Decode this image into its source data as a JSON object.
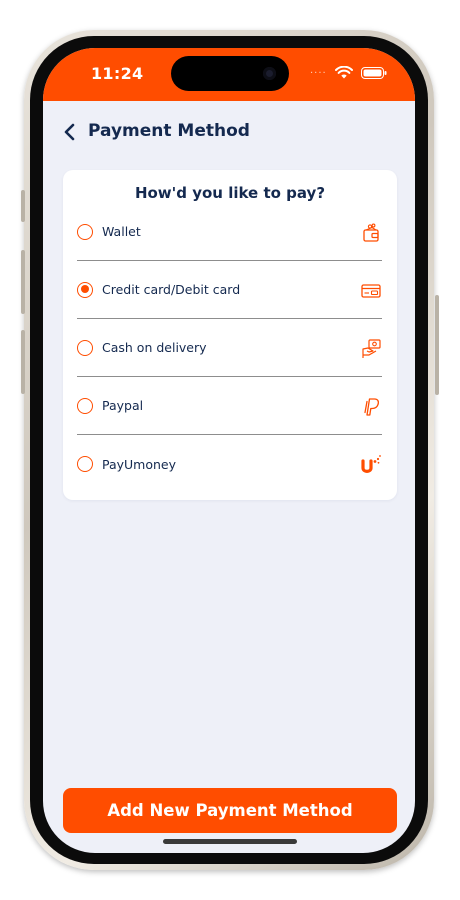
{
  "status_bar": {
    "time": "11:24",
    "signal_dots": "....",
    "background": "#ff4d00"
  },
  "header": {
    "title": "Payment Method",
    "back_icon": "chevron-left-icon"
  },
  "payment_card": {
    "title": "How'd you like to pay?",
    "options": [
      {
        "label": "Wallet",
        "icon": "wallet-icon",
        "selected": false
      },
      {
        "label": "Credit card/Debit card",
        "icon": "credit-card-icon",
        "selected": true
      },
      {
        "label": "Cash on delivery",
        "icon": "cash-icon",
        "selected": false
      },
      {
        "label": "Paypal",
        "icon": "paypal-icon",
        "selected": false
      },
      {
        "label": "PayUmoney",
        "icon": "payumoney-icon",
        "selected": false
      }
    ]
  },
  "footer": {
    "button_label": "Add New Payment Method"
  },
  "colors": {
    "accent": "#ff4d00",
    "text_primary": "#14294f",
    "screen_background": "#eef0f8",
    "card_background": "#ffffff"
  }
}
